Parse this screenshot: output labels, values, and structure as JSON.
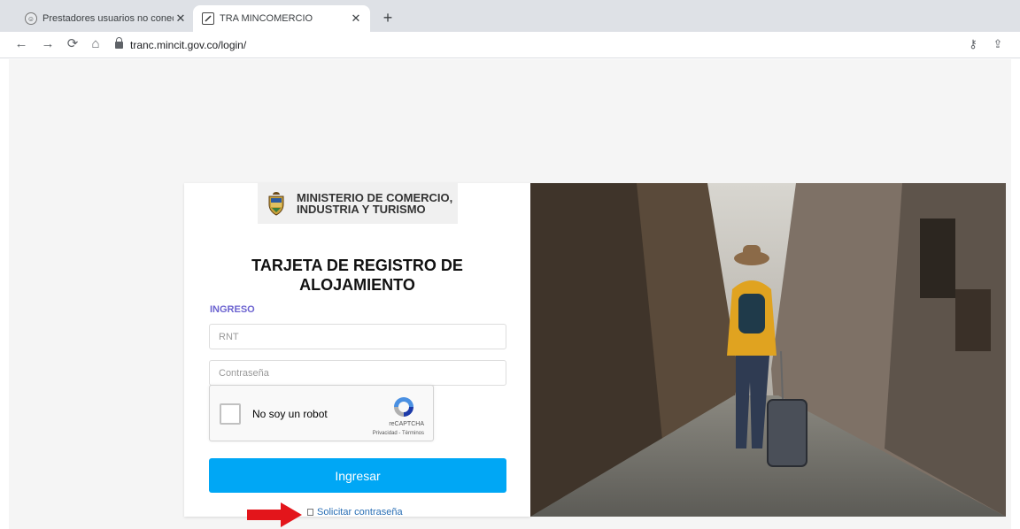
{
  "browser": {
    "tabs": [
      {
        "title": "Prestadores usuarios no conectados",
        "active": false,
        "close": "✕"
      },
      {
        "title": "TRA MINCOMERCIO",
        "active": true,
        "close": "✕"
      }
    ],
    "new_tab": "+",
    "url": "tranc.mincit.gov.co/login/",
    "icons": [
      "back-icon",
      "forward-icon",
      "reload-icon",
      "home-icon",
      "lock-icon",
      "key-icon",
      "share-icon"
    ]
  },
  "login": {
    "ministry_line1": "MINISTERIO DE COMERCIO,",
    "ministry_line2": "INDUSTRIA Y TURISMO",
    "title_line1": "TARJETA DE REGISTRO DE",
    "title_line2": "ALOJAMIENTO",
    "section_label": "INGRESO",
    "rnt_placeholder": "RNT",
    "password_placeholder": "Contraseña",
    "recaptcha_label": "No soy un robot",
    "recaptcha_brand": "reCAPTCHA",
    "recaptcha_links": "Privacidad - Términos",
    "submit_label": "Ingresar",
    "forgot_label": "Solicitar contraseña"
  },
  "colors": {
    "submit_button": "#00a7f5",
    "section_label": "#6c63d0",
    "link": "#2a6fb5",
    "annotation_arrow": "#e3151b"
  }
}
